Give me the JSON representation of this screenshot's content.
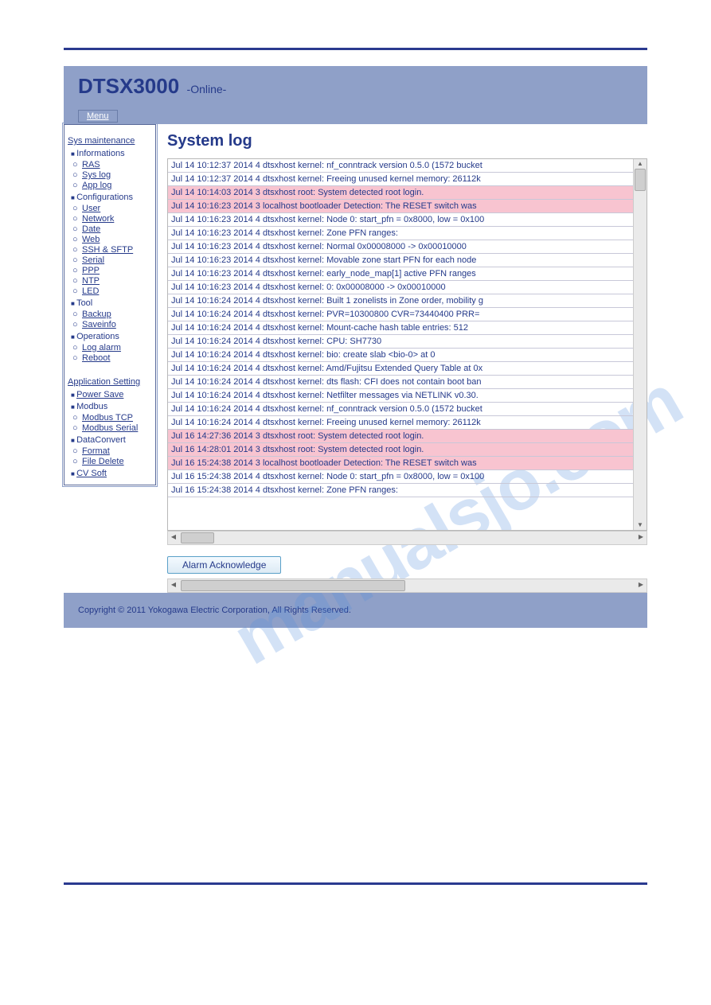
{
  "header": {
    "title": "DTSX3000",
    "status": "-Online-",
    "menu_label": "Menu"
  },
  "sidebar": {
    "section1_title": "Sys maintenance",
    "groups1": [
      {
        "label": "Informations",
        "items": [
          "RAS",
          "Sys log",
          "App log"
        ]
      },
      {
        "label": "Configurations",
        "items": [
          "User",
          "Network",
          "Date",
          "Web",
          "SSH & SFTP",
          "Serial",
          "PPP",
          "NTP",
          "LED"
        ]
      },
      {
        "label": "Tool",
        "items": [
          "Backup",
          "Saveinfo"
        ]
      },
      {
        "label": "Operations",
        "items": [
          "Log alarm",
          "Reboot"
        ]
      }
    ],
    "section2_title": "Application Setting",
    "groups2": [
      {
        "label": "Power Save",
        "items": []
      },
      {
        "label": "Modbus",
        "items": [
          "Modbus TCP",
          "Modbus Serial"
        ]
      },
      {
        "label": "DataConvert",
        "items": [
          "Format",
          "File Delete"
        ]
      },
      {
        "label": "CV Soft",
        "items": []
      }
    ]
  },
  "main": {
    "heading": "System log",
    "ack_label": "Alarm Acknowledge",
    "log": [
      {
        "t": "Jul 14 10:12:37 2014 4 dtsxhost kernel: nf_conntrack version 0.5.0 (1572 bucket",
        "hl": false
      },
      {
        "t": "Jul 14 10:12:37 2014 4 dtsxhost kernel: Freeing unused kernel memory: 26112k",
        "hl": false
      },
      {
        "t": "Jul 14 10:14:03 2014 3 dtsxhost root: System detected root login.",
        "hl": true
      },
      {
        "t": "Jul 14 10:16:23 2014 3 localhost bootloader Detection: The RESET switch was",
        "hl": true
      },
      {
        "t": "Jul 14 10:16:23 2014 4 dtsxhost kernel: Node 0: start_pfn = 0x8000, low = 0x100",
        "hl": false
      },
      {
        "t": "Jul 14 10:16:23 2014 4 dtsxhost kernel: Zone PFN ranges:",
        "hl": false
      },
      {
        "t": "Jul 14 10:16:23 2014 4 dtsxhost kernel: Normal 0x00008000 -> 0x00010000",
        "hl": false
      },
      {
        "t": "Jul 14 10:16:23 2014 4 dtsxhost kernel: Movable zone start PFN for each node",
        "hl": false
      },
      {
        "t": "Jul 14 10:16:23 2014 4 dtsxhost kernel: early_node_map[1] active PFN ranges",
        "hl": false
      },
      {
        "t": "Jul 14 10:16:23 2014 4 dtsxhost kernel: 0: 0x00008000 -> 0x00010000",
        "hl": false
      },
      {
        "t": "Jul 14 10:16:24 2014 4 dtsxhost kernel: Built 1 zonelists in Zone order, mobility g",
        "hl": false
      },
      {
        "t": "Jul 14 10:16:24 2014 4 dtsxhost kernel: PVR=10300800 CVR=73440400 PRR=",
        "hl": false
      },
      {
        "t": "Jul 14 10:16:24 2014 4 dtsxhost kernel: Mount-cache hash table entries: 512",
        "hl": false
      },
      {
        "t": "Jul 14 10:16:24 2014 4 dtsxhost kernel: CPU: SH7730",
        "hl": false
      },
      {
        "t": "Jul 14 10:16:24 2014 4 dtsxhost kernel: bio: create slab <bio-0> at 0",
        "hl": false
      },
      {
        "t": "Jul 14 10:16:24 2014 4 dtsxhost kernel: Amd/Fujitsu Extended Query Table at 0x",
        "hl": false
      },
      {
        "t": "Jul 14 10:16:24 2014 4 dtsxhost kernel: dts flash: CFI does not contain boot ban",
        "hl": false
      },
      {
        "t": "Jul 14 10:16:24 2014 4 dtsxhost kernel: Netfilter messages via NETLINK v0.30.",
        "hl": false
      },
      {
        "t": "Jul 14 10:16:24 2014 4 dtsxhost kernel: nf_conntrack version 0.5.0 (1572 bucket",
        "hl": false
      },
      {
        "t": "Jul 14 10:16:24 2014 4 dtsxhost kernel: Freeing unused kernel memory: 26112k",
        "hl": false
      },
      {
        "t": "Jul 16 14:27:36 2014 3 dtsxhost root: System detected root login.",
        "hl": true
      },
      {
        "t": "Jul 16 14:28:01 2014 3 dtsxhost root: System detected root login.",
        "hl": true
      },
      {
        "t": "Jul 16 15:24:38 2014 3 localhost bootloader Detection: The RESET switch was",
        "hl": true
      },
      {
        "t": "Jul 16 15:24:38 2014 4 dtsxhost kernel: Node 0: start_pfn = 0x8000, low = 0x100",
        "hl": false
      },
      {
        "t": "Jul 16 15:24:38 2014 4 dtsxhost kernel: Zone PFN ranges:",
        "hl": false
      }
    ]
  },
  "footer": {
    "copyright": "Copyright © 2011 Yokogawa Electric Corporation, All Rights Reserved."
  },
  "watermark": "manualsjo.com"
}
